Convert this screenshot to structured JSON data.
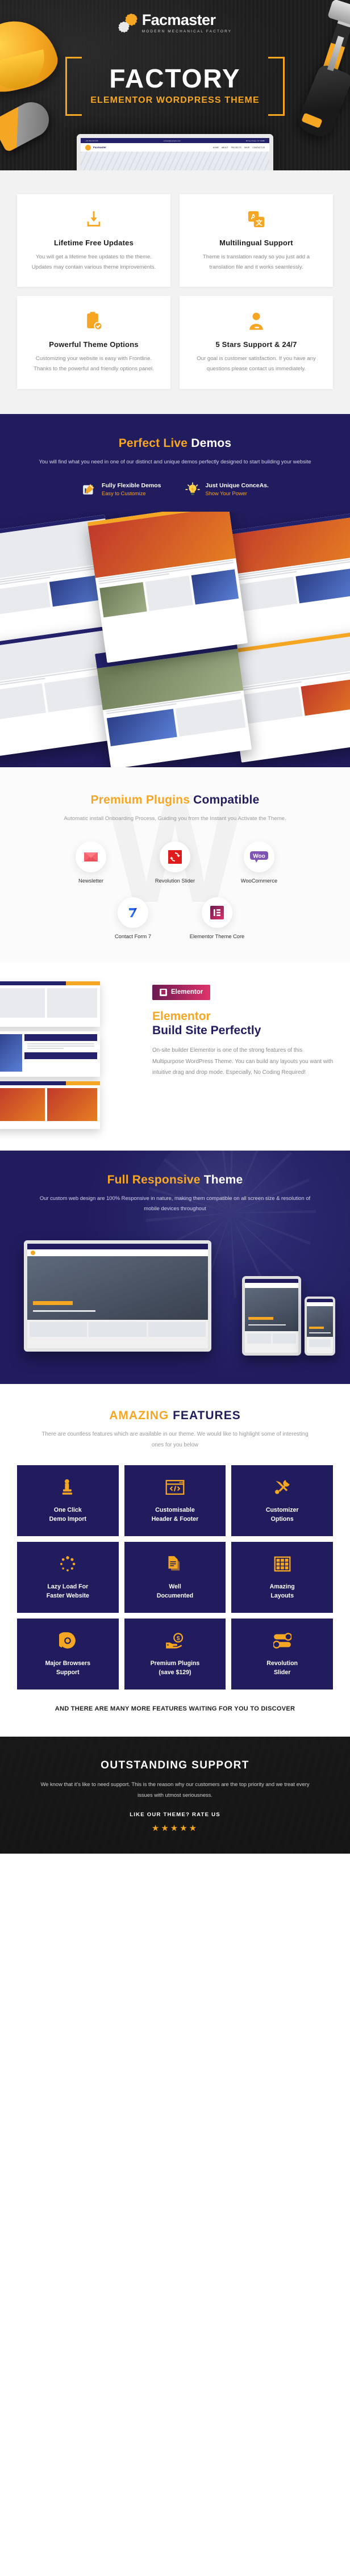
{
  "hero": {
    "brand": "Facmaster",
    "brand_tagline": "MODERN MECHANICAL FACTORY",
    "title": "FACTORY",
    "subtitle": "ELEMENTOR WORDPRESS THEME",
    "mock": {
      "topbar_phone": "+49 354 415 235",
      "topbar_email": "contact@example.com",
      "topbar_address": "85 Sea Tower, NY 10089",
      "brand": "Facmaster",
      "brand_sub": "MECHANICAL FACTORY",
      "nav": [
        "HOME",
        "ABOUT",
        "PROJECTS",
        "SHOP",
        "CONTACT US"
      ]
    }
  },
  "feature_cards": [
    {
      "icon": "download-icon",
      "title": "Lifetime Free Updates",
      "text": "You will get a lifetime free updates to the theme. Updates may contain various theme improvements."
    },
    {
      "icon": "translate-icon",
      "title": "Multilingual Support",
      "text": "Theme is translation ready so you just add a translation file and it works seamlessly."
    },
    {
      "icon": "clipboard-check-icon",
      "title": "Powerful Theme Options",
      "text": "Customizing your website is easy with Frontline. Thanks to the powerful and friendly options panel."
    },
    {
      "icon": "headset-support-icon",
      "title": "5 Stars Support & 24/7",
      "text": "Our goal is customer satisfaction. If you have any questions please contact us immediately."
    }
  ],
  "demos": {
    "title_accent": "Perfect Live",
    "title_rest": "Demos",
    "subtitle": "You will find what you need in one of our distinct and unique demos perfectly designed to start building your website",
    "badges": [
      {
        "icon": "blueprint-pencil-icon",
        "title": "Fully Flexible Demos",
        "sub": "Easy to Customize"
      },
      {
        "icon": "lightbulb-idea-icon",
        "title": "Just Unique ConceAs.",
        "sub": "Show Your Power"
      }
    ]
  },
  "plugins": {
    "title_accent": "Premium Plugins",
    "title_rest": "Compatible",
    "subtitle": "Automatic install Onboarding Process, Guiding you from the Instant you Activate the Theme.",
    "ghost_letter": "W",
    "items_row1": [
      {
        "icon": "newsletter-envelope-icon",
        "name": "Newsletter"
      },
      {
        "icon": "revolution-slider-icon",
        "name": "Revolution Slider"
      },
      {
        "icon": "woocommerce-icon",
        "name": "WooCommerce"
      }
    ],
    "items_row2": [
      {
        "icon": "contact-form-7-icon",
        "name": "Contact Form 7"
      },
      {
        "icon": "elementor-icon",
        "name": "Elementor Theme Core"
      }
    ]
  },
  "elementor": {
    "badge": "Elementor",
    "heading_accent": "Elementor",
    "heading_rest": "Build Site Perfectly",
    "text": "On-site builder Elementor is one of the strong features of this Multipurpose WordPress Theme. You can build any layouts you want with intuitive drag and drop mode. Especially, No Coding Required!"
  },
  "responsive": {
    "title_accent": "Full Responsive",
    "title_rest": "Theme",
    "subtitle": "Our custom web design are 100% Responsive in nature, making them compatible on all screen size & resolution of mobile devices throughout"
  },
  "amazing": {
    "title_accent": "AMAZING",
    "title_rest": "FEATURES",
    "subtitle": "There are countless features which are available in our theme. We would like to highlight some of interesting ones for you below",
    "items": [
      {
        "icon": "click-hand-icon",
        "title": "One Click\nDemo Import"
      },
      {
        "icon": "code-window-icon",
        "title": "Customisable\nHeader & Footer"
      },
      {
        "icon": "tools-icon",
        "title": "Customizer\nOptions"
      },
      {
        "icon": "spinner-loader-icon",
        "title": "Lazy Load For\nFaster Website"
      },
      {
        "icon": "document-icon",
        "title": "Well\nDocumented"
      },
      {
        "icon": "grid-layout-icon",
        "title": "Amazing\nLayouts"
      },
      {
        "icon": "chrome-browser-icon",
        "title": "Major Browsers\nSupport"
      },
      {
        "icon": "money-hand-icon",
        "title": "Premium Plugins\n(save $129)"
      },
      {
        "icon": "toggle-slider-icon",
        "title": "Revolution\nSlider"
      }
    ],
    "footer_note": "AND THERE ARE MANY MORE FEATURES WAITING FOR YOU TO DISCOVER"
  },
  "support": {
    "title": "OUTSTANDING SUPPORT",
    "text": "We know  that it's like to need support. This is the reason why our customers are the top priority and we treat every issues with utmost seriousness.",
    "rate_label": "LIKE OUR THEME? RATE US",
    "stars": "★★★★★"
  },
  "colors": {
    "accent": "#f5a623",
    "navy": "#211c5e",
    "dark": "#1f1f1f",
    "muted": "#8b8b8b"
  }
}
